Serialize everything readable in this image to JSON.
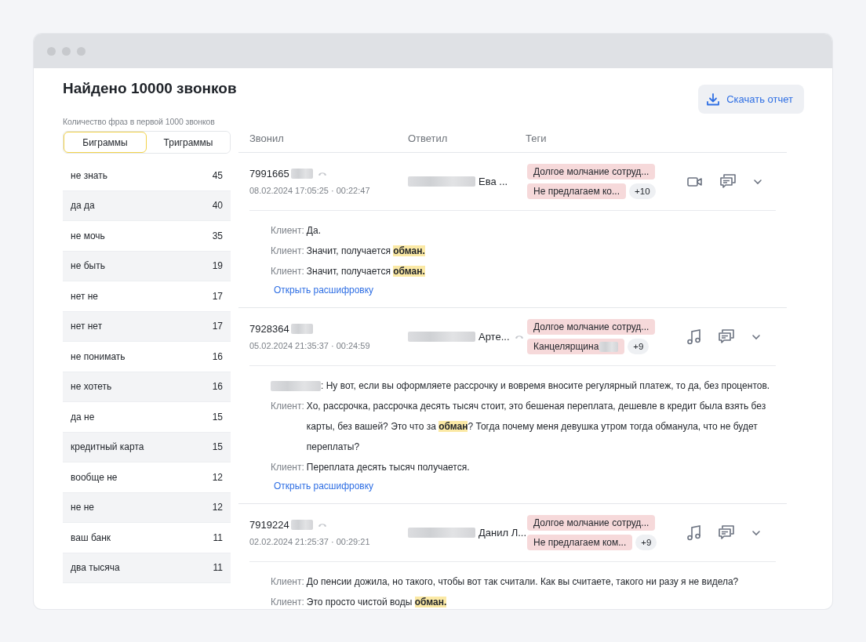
{
  "title": "Найдено 10000 звонков",
  "download_button": "Скачать отчет",
  "phrases": {
    "caption": "Количество фраз в первой 1000 звонков",
    "tabs": [
      {
        "label": "Биграммы",
        "selected": true
      },
      {
        "label": "Триграммы",
        "selected": false
      }
    ],
    "rows": [
      {
        "phrase": "не знать",
        "count": "45"
      },
      {
        "phrase": "да да",
        "count": "40"
      },
      {
        "phrase": "не мочь",
        "count": "35"
      },
      {
        "phrase": "не быть",
        "count": "19"
      },
      {
        "phrase": "нет не",
        "count": "17"
      },
      {
        "phrase": "нет нет",
        "count": "17"
      },
      {
        "phrase": "не понимать",
        "count": "16"
      },
      {
        "phrase": "не хотеть",
        "count": "16"
      },
      {
        "phrase": "да не",
        "count": "15"
      },
      {
        "phrase": "кредитный карта",
        "count": "15"
      },
      {
        "phrase": "вообще не",
        "count": "12"
      },
      {
        "phrase": "не не",
        "count": "12"
      },
      {
        "phrase": "ваш банк",
        "count": "11"
      },
      {
        "phrase": "два тысяча",
        "count": "11"
      }
    ]
  },
  "calls": {
    "columns": [
      "Звонил",
      "Ответил",
      "Теги"
    ],
    "rows": [
      {
        "caller": {
          "number": "7991665",
          "redacted": true,
          "redirect": true
        },
        "datetime": "08.02.2024 17:05:25 · 00:22:47",
        "agent": {
          "name": "Ева ...",
          "redacted": true,
          "redirect": false
        },
        "tags": [
          {
            "text": "Долгое молчание сотруд...",
            "redacted": false
          },
          {
            "text": "Не предлагаем ко...",
            "redacted": false
          }
        ],
        "more": "+10",
        "media": {
          "kind": "video"
        },
        "messages": [
          {
            "speaker": "Клиент:",
            "text": "Да."
          },
          {
            "speaker": "Клиент:",
            "text": "Значит, получается **обман.**"
          },
          {
            "speaker": "Клиент:",
            "text": "Значит, получается **обман.**"
          }
        ],
        "link": "Открыть расшифровку"
      },
      {
        "caller": {
          "number": "7928364",
          "redacted": true,
          "redirect": false
        },
        "datetime": "05.02.2024 21:35:37 · 00:24:59",
        "agent": {
          "name": "Арте...",
          "redacted": true,
          "redirect": true
        },
        "tags": [
          {
            "text": "Долгое молчание сотруд...",
            "redacted": false
          },
          {
            "text": "Канцелярщина",
            "redacted": true
          }
        ],
        "more": "+9",
        "media": {
          "kind": "audio"
        },
        "messages": [
          {
            "text": ": Ну вот, если вы оформляете рассрочку и вовремя вносите регулярный платеж, то да, без процентов."
          },
          {
            "speaker": "Клиент:",
            "text": "Хо, рассрочка, рассрочка десять тысяч стоит, это бешеная переплата, дешевле в кредит была взять без карты, без вашей? Это что за **обман**? Тогда почему меня девушка утром тогда обманула, что не будет переплаты?"
          },
          {
            "speaker": "Клиент:",
            "text": "Переплата десять тысяч получается."
          }
        ],
        "link": "Открыть расшифровку"
      },
      {
        "caller": {
          "number": "7919224",
          "redacted": true,
          "redirect": true
        },
        "datetime": "02.02.2024 21:25:37 · 00:29:21",
        "agent": {
          "name": "Данил Л...",
          "redacted": true,
          "redirect": false
        },
        "tags": [
          {
            "text": "Долгое молчание сотруд...",
            "redacted": false
          },
          {
            "text": "Не предлагаем ком...",
            "redacted": false
          }
        ],
        "more": "+9",
        "media": {
          "kind": "audio"
        },
        "messages": [
          {
            "speaker": "Клиент:",
            "text": "До пенсии дожила, но такого, чтобы вот так считали. Как вы считаете, такого ни разу я не видела?"
          },
          {
            "speaker": "Клиент:",
            "text": "Это просто чистой воды **обман.**"
          }
        ]
      }
    ]
  }
}
